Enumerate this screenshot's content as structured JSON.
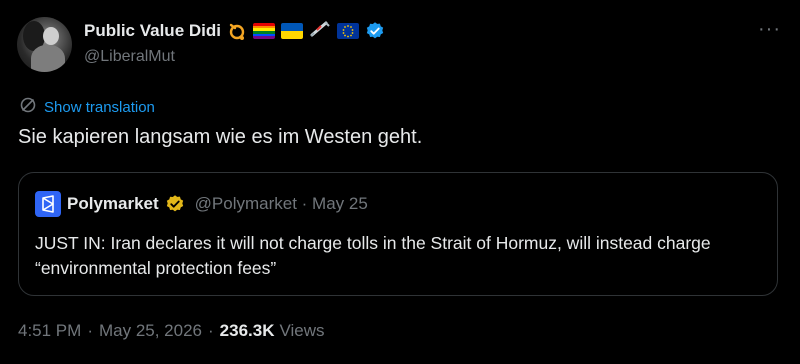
{
  "author": {
    "display_name": "Public Value Didi",
    "handle": "@LiberalMut",
    "avatar_icon": "avatar-photo",
    "name_emojis": [
      "post-horn-emoji",
      "rainbow-flag-emoji",
      "ukraine-flag-emoji",
      "syringe-emoji",
      "eu-flag-emoji"
    ],
    "verified_color": "#1d9bf0"
  },
  "more_label": "···",
  "translation": {
    "label": "Show translation",
    "icon": "globe-icon"
  },
  "tweet_text": "Sie kapieren langsam wie es im Westen geht.",
  "quoted": {
    "name": "Polymarket",
    "handle_date": "@Polymarket · May 25",
    "text": "JUST IN: Iran declares it will not charge tolls in the Strait of Hormuz, will instead charge “environmental protection fees”",
    "logo_color": "#2f65f5",
    "badge_color": "#e2b719"
  },
  "meta": {
    "time": "4:51 PM",
    "date": "May 25, 2026",
    "sep": "·",
    "views_count": "236.3K",
    "views_label": "Views"
  },
  "colors": {
    "background": "#000000",
    "text": "#e7e9ea",
    "muted": "#71767b",
    "link": "#1d9bf0"
  }
}
